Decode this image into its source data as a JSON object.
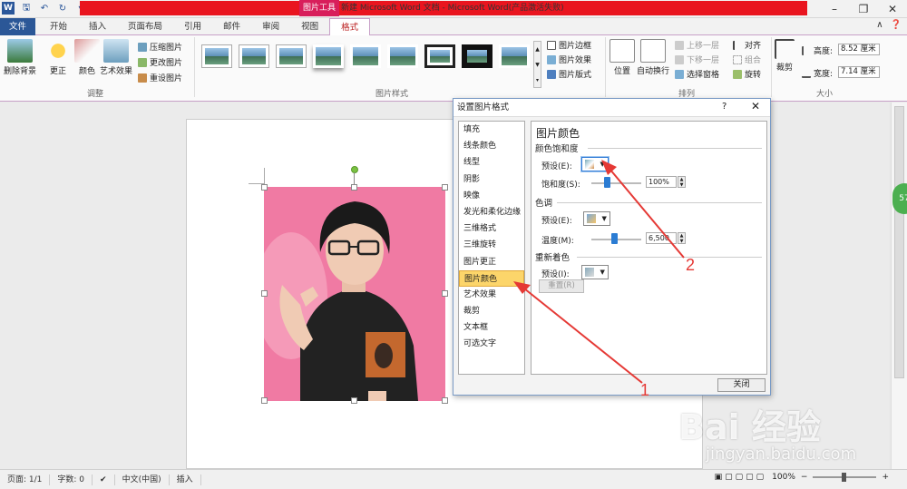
{
  "titlebar": {
    "context_tab": "图片工具",
    "title": "新建 Microsoft Word 文档 - Microsoft Word(产品激活失败)"
  },
  "tabs": [
    {
      "label": "文件"
    },
    {
      "label": "开始"
    },
    {
      "label": "插入"
    },
    {
      "label": "页面布局"
    },
    {
      "label": "引用"
    },
    {
      "label": "邮件"
    },
    {
      "label": "审阅"
    },
    {
      "label": "视图"
    },
    {
      "label": "格式"
    }
  ],
  "ribbon": {
    "adjust": {
      "remove_bg": "删除背景",
      "corrections": "更正",
      "color": "颜色",
      "artistic": "艺术效果",
      "compress": "压缩图片",
      "change": "更改图片",
      "reset": "重设图片",
      "label": "调整"
    },
    "styles": {
      "border": "图片边框",
      "effects": "图片效果",
      "layout": "图片版式",
      "label": "图片样式"
    },
    "arrange": {
      "position": "位置",
      "wrap": "自动换行",
      "bring_forward": "上移一层",
      "send_backward": "下移一层",
      "selection_pane": "选择窗格",
      "align": "对齐",
      "group": "组合",
      "rotate": "旋转",
      "label": "排列"
    },
    "size": {
      "crop": "裁剪",
      "height_label": "高度:",
      "height_value": "8.52 厘米",
      "width_label": "宽度:",
      "width_value": "7.14 厘米",
      "label": "大小"
    }
  },
  "dialog": {
    "title": "设置图片格式",
    "help": "?",
    "categories": [
      "填充",
      "线条颜色",
      "线型",
      "阴影",
      "映像",
      "发光和柔化边缘",
      "三维格式",
      "三维旋转",
      "图片更正",
      "图片颜色",
      "艺术效果",
      "裁剪",
      "文本框",
      "可选文字"
    ],
    "selected_category": "图片颜色",
    "panel": {
      "title": "图片颜色",
      "saturation_section": "颜色饱和度",
      "saturation_preset_label": "预设(E):",
      "saturation_label": "饱和度(S):",
      "saturation_value": "100%",
      "tone_section": "色调",
      "tone_preset_label": "预设(E):",
      "temperature_label": "温度(M):",
      "temperature_value": "6,500",
      "recolor_section": "重新着色",
      "recolor_preset_label": "预设(I):",
      "reset_button": "重置(R)"
    },
    "close_button": "关闭"
  },
  "annotations": {
    "one": "1",
    "two": "2"
  },
  "statusbar": {
    "page": "页面: 1/1",
    "words": "字数: 0",
    "language": "中文(中国)",
    "mode": "插入",
    "zoom": "100%"
  },
  "side_badge": "57",
  "watermark": {
    "brand": "Bai 经验",
    "url": "jingyan.baidu.com"
  },
  "colors": {
    "accent_red": "#e9151f",
    "file_tab": "#2b5797",
    "selection": "#fcd56a",
    "slider": "#2b7cd3",
    "arrow": "#e53935"
  }
}
